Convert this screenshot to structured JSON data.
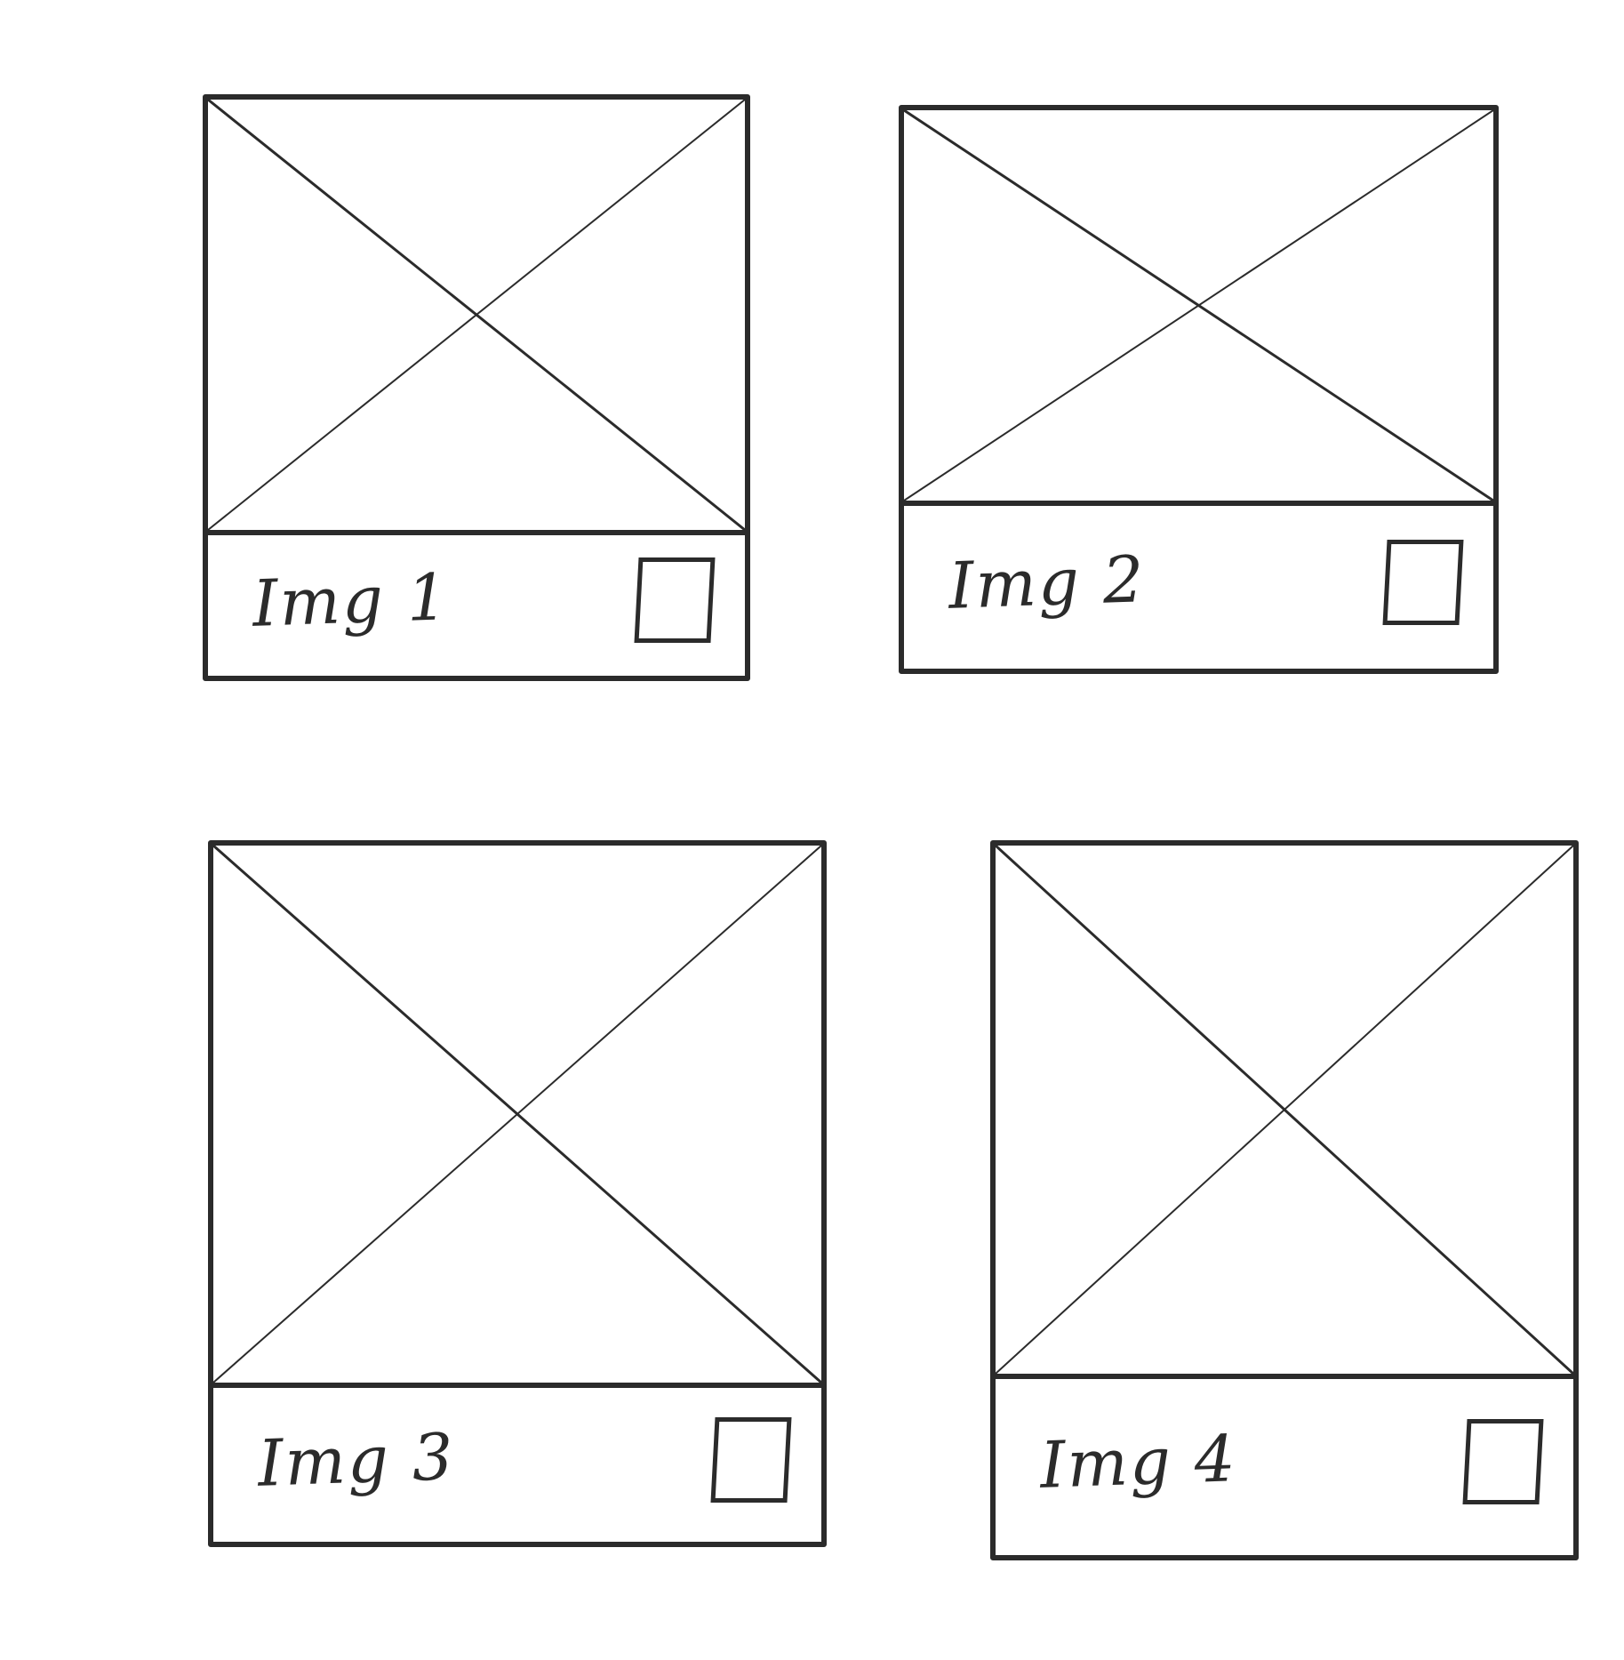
{
  "cards": [
    {
      "label": "Img 1",
      "checked": false
    },
    {
      "label": "Img 2",
      "checked": false
    },
    {
      "label": "Img 3",
      "checked": false
    },
    {
      "label": "Img 4",
      "checked": false
    }
  ],
  "colors": {
    "ink": "#2b2b2b",
    "paper": "#ffffff"
  },
  "icons": {
    "image_placeholder": "image-placeholder-icon",
    "checkbox": "checkbox-icon"
  }
}
